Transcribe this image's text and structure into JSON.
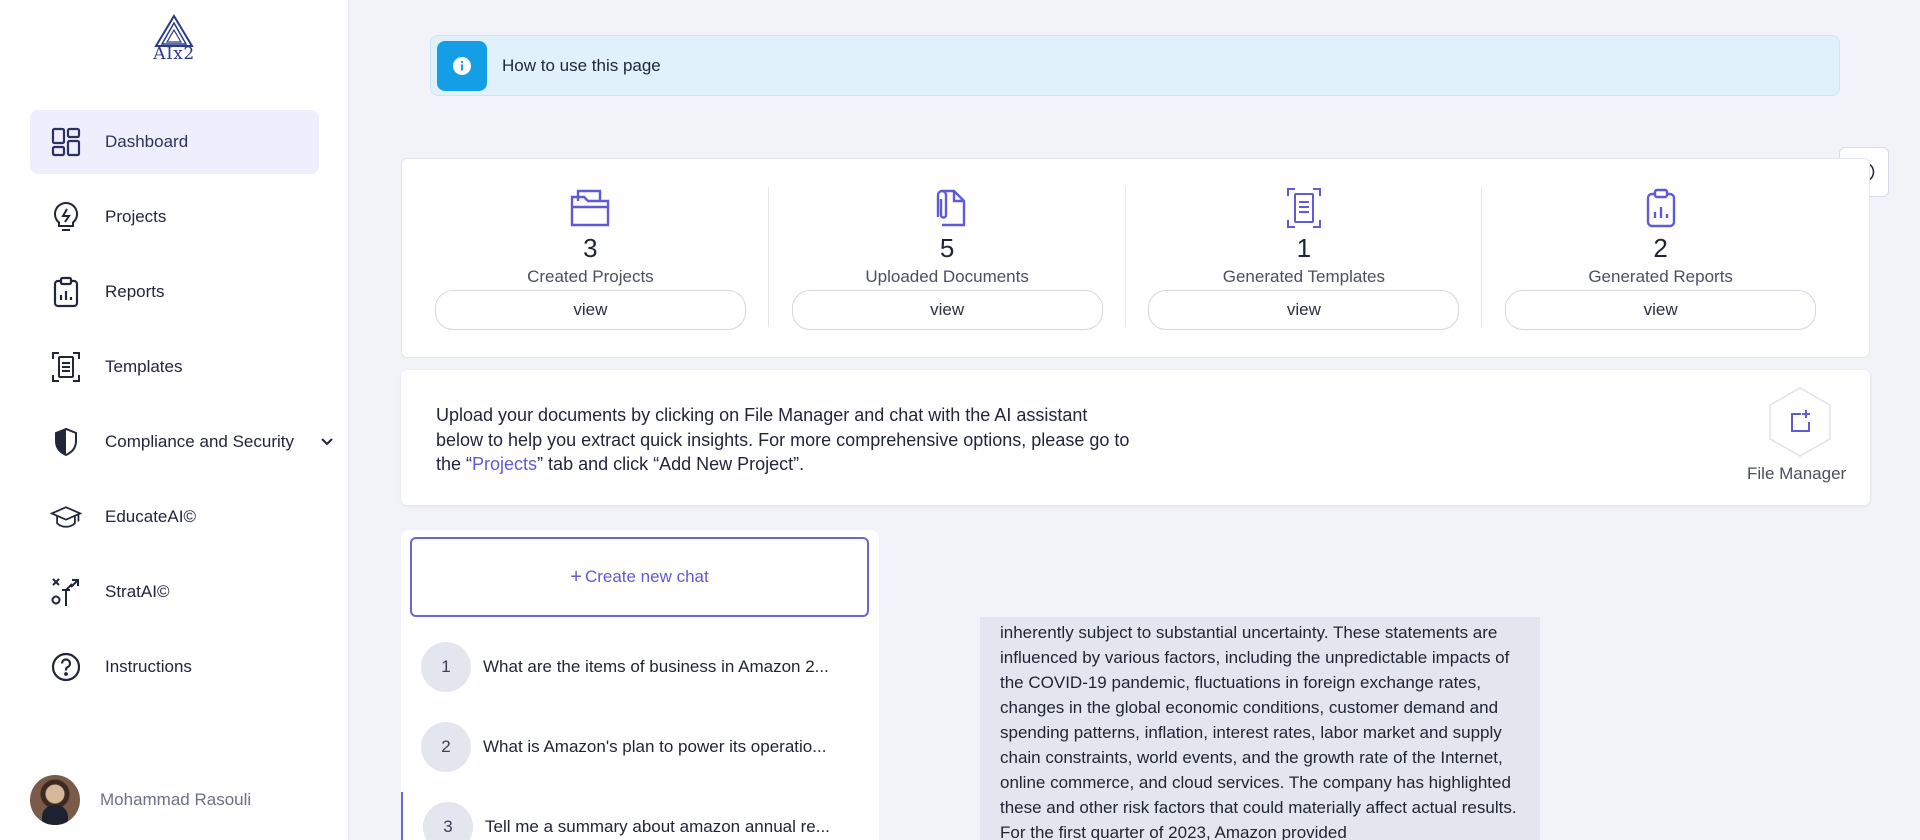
{
  "sidebar": {
    "logo_text": "AIx2",
    "items": [
      {
        "label": "Dashboard",
        "icon": "dashboard-icon"
      },
      {
        "label": "Projects",
        "icon": "bulb-icon"
      },
      {
        "label": "Reports",
        "icon": "clipboard-icon"
      },
      {
        "label": "Templates",
        "icon": "template-icon"
      },
      {
        "label": "Compliance and Security",
        "icon": "shield-icon"
      },
      {
        "label": "EducateAI©",
        "icon": "graduation-cap-icon"
      },
      {
        "label": "StratAI©",
        "icon": "strategy-icon"
      },
      {
        "label": "Instructions",
        "icon": "question-icon"
      }
    ],
    "user_name": "Mohammad Rasouli"
  },
  "banner": {
    "text": "How to use this page"
  },
  "stats": [
    {
      "value": "3",
      "label": "Created Projects",
      "button": "view"
    },
    {
      "value": "5",
      "label": "Uploaded Documents",
      "button": "view"
    },
    {
      "value": "1",
      "label": "Generated Templates",
      "button": "view"
    },
    {
      "value": "2",
      "label": "Generated Reports",
      "button": "view"
    }
  ],
  "upload": {
    "text_before": "Upload your documents by clicking on File Manager and chat with the AI assistant below to help you extract quick insights. For more comprehensive options, please go to the “",
    "link": "Projects",
    "text_after": "” tab and click “Add New Project”.",
    "file_manager_label": "File Manager"
  },
  "chats": {
    "new_label": "Create new chat",
    "items": [
      {
        "num": "1",
        "title": "What are the items of business in Amazon 2..."
      },
      {
        "num": "2",
        "title": "What is Amazon's plan to power its operatio..."
      },
      {
        "num": "3",
        "title": "Tell me a summary about amazon annual re..."
      }
    ]
  },
  "message": {
    "text": "inherently subject to substantial uncertainty. These statements are influenced by various factors, including the unpredictable impacts of the COVID-19 pandemic, fluctuations in foreign exchange rates, changes in the global economic conditions, customer demand and spending patterns, inflation, interest rates, labor market and supply chain constraints, world events, and the growth rate of the Internet, online commerce, and cloud services. The company has highlighted these and other risk factors that could materially affect actual results. For the first quarter of 2023, Amazon provided"
  },
  "colors": {
    "accent": "#5f5bd6",
    "info": "#139ee6",
    "active_bg": "#efeefc"
  }
}
